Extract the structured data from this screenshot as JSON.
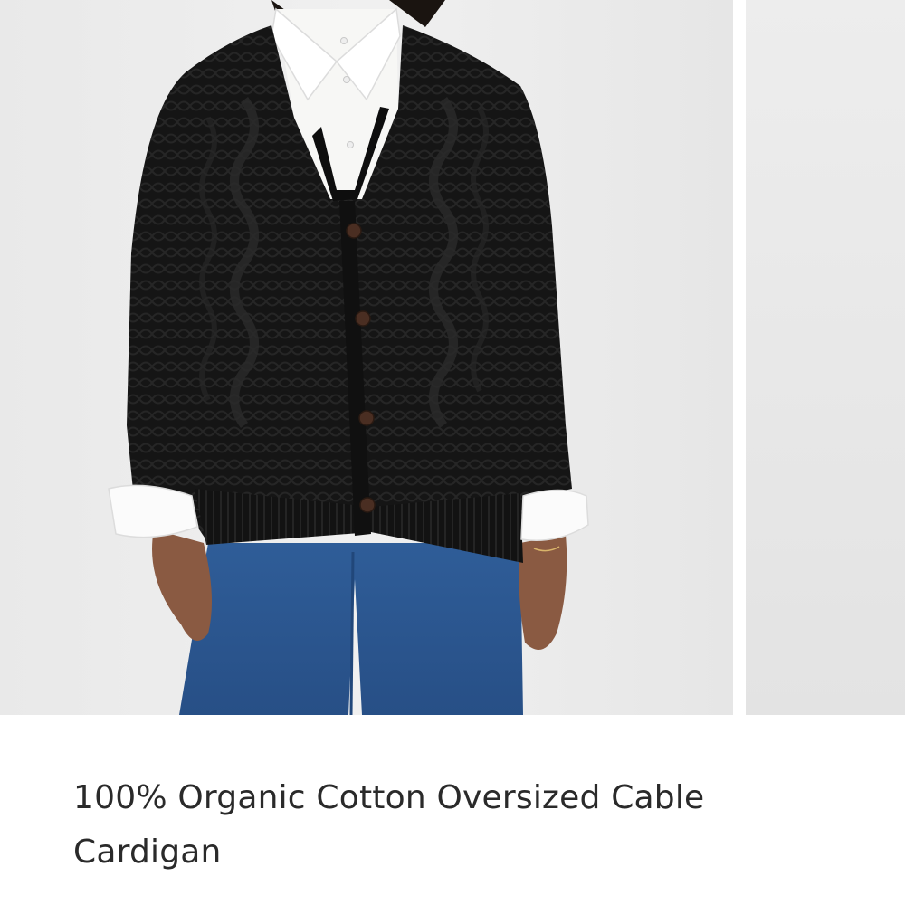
{
  "gallery": {
    "images": [
      {
        "subject": "model-wearing-black-cable-cardigan-over-white-shirt-and-blue-jeans"
      },
      {
        "subject": "next-product-image-partial"
      }
    ]
  },
  "product": {
    "title": "100% Organic Cotton Oversized Cable Cardigan"
  },
  "colors": {
    "background": "#ffffff",
    "photo_backdrop": "#ececec",
    "cardigan": "#141414",
    "shirt": "#f7f7f5",
    "denim": "#2e5a94",
    "skin": "#8a5a42",
    "title_text": "#2a2a2a"
  }
}
